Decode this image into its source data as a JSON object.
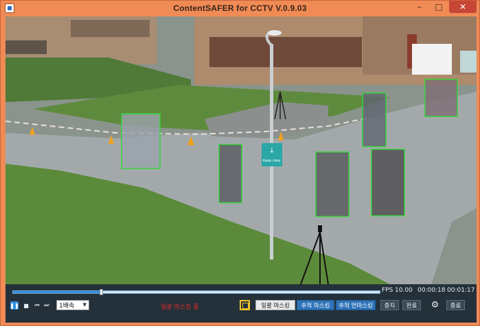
{
  "window": {
    "title": "ContentSAFER for CCTV V.0.9.03",
    "minimize": "–",
    "maximize": "□",
    "close": "✕"
  },
  "video": {
    "sign_text": "↓",
    "sign_subtext": "Keep clear"
  },
  "playback": {
    "progress": 0.24,
    "fps_label": "FPS",
    "fps_value": "10.00",
    "current_time": "00:00:18",
    "total_time": "00:01:17"
  },
  "controls": {
    "pause_icon": "❚❚",
    "stop_icon": "■",
    "prev_icon": "⏮",
    "next_icon": "⏭",
    "speed_value": "1배속",
    "status_text": "일괄 마스킹 중",
    "batch_mask_label": "일괄 마스킹",
    "track_mask_label": "추적 마스킹",
    "track_unmask_label": "추적 언마스킹",
    "stop_label": "중지",
    "finish_label": "완료",
    "settings_icon": "⚙",
    "exit_label": "종료"
  },
  "colors": {
    "titlebar": "#f08b56",
    "detection_box": "#35d43a",
    "progress_fill": "#2f8de0",
    "status_text": "#e22a2a",
    "active_button": "#2f74b9"
  }
}
